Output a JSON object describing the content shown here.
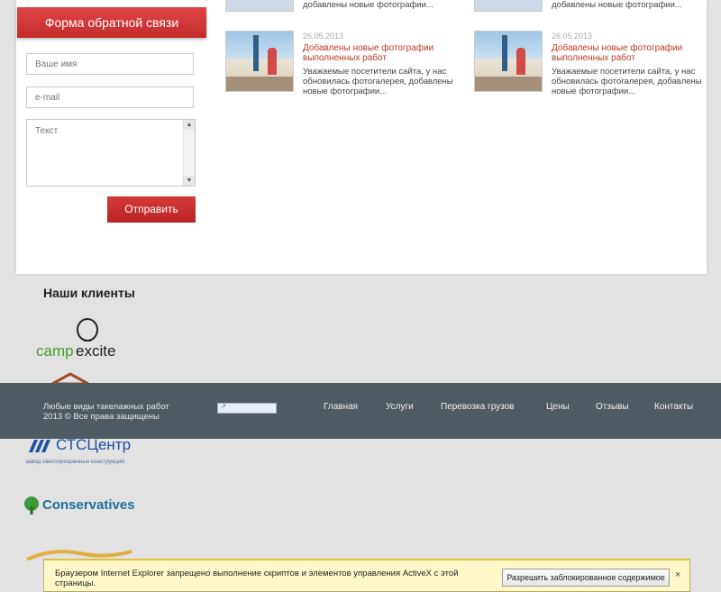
{
  "feedback": {
    "title": "Форма обратной связи",
    "name_placeholder": "Ваше имя",
    "email_placeholder": "e-mail",
    "text_placeholder": "Текст",
    "submit_label": "Отправить"
  },
  "news_top": [
    {
      "text": "добавлены новые фотографии..."
    },
    {
      "text": "добавлены новые фотографии..."
    }
  ],
  "news": [
    {
      "date": "26.05.2013",
      "title": "Добавлены новые фотографии выполненных работ",
      "text": "Уважаемые посетители сайта, у нас обновилась фотогалерея, добавлены новые фотографии..."
    },
    {
      "date": "26.05.2013",
      "title": "Добавлены новые фотографии выполненных работ",
      "text": "Уважаемые посетители сайта, у нас обновилась фотогалерея, добавлены новые фотографии..."
    }
  ],
  "clients": {
    "title": "Наши клиенты",
    "logos": {
      "campexcite_a": "camp",
      "campexcite_b": "excite",
      "stc_main": "СТСЦентр",
      "stc_sub": "завод светопрозрачных конструкций",
      "conservatives": "Conservatives"
    }
  },
  "footer": {
    "copy_line1": "Любые виды такелажных работ",
    "copy_line2": "2013 © Все права защищены",
    "nav": [
      "Главная",
      "Услуги",
      "Перевозка грузов",
      "Цены",
      "Отзывы",
      "Контакты"
    ]
  },
  "ie_bar": {
    "message": "Браузером Internet Explorer запрещено выполнение скриптов и элементов управления ActiveX с этой страницы.",
    "allow_label": "Разрешить заблокированное содержимое",
    "close_symbol": "×"
  },
  "colors": {
    "accent": "#c42c2c",
    "footer_bg": "#4f5b63",
    "page_bg": "#e2e2e2"
  }
}
